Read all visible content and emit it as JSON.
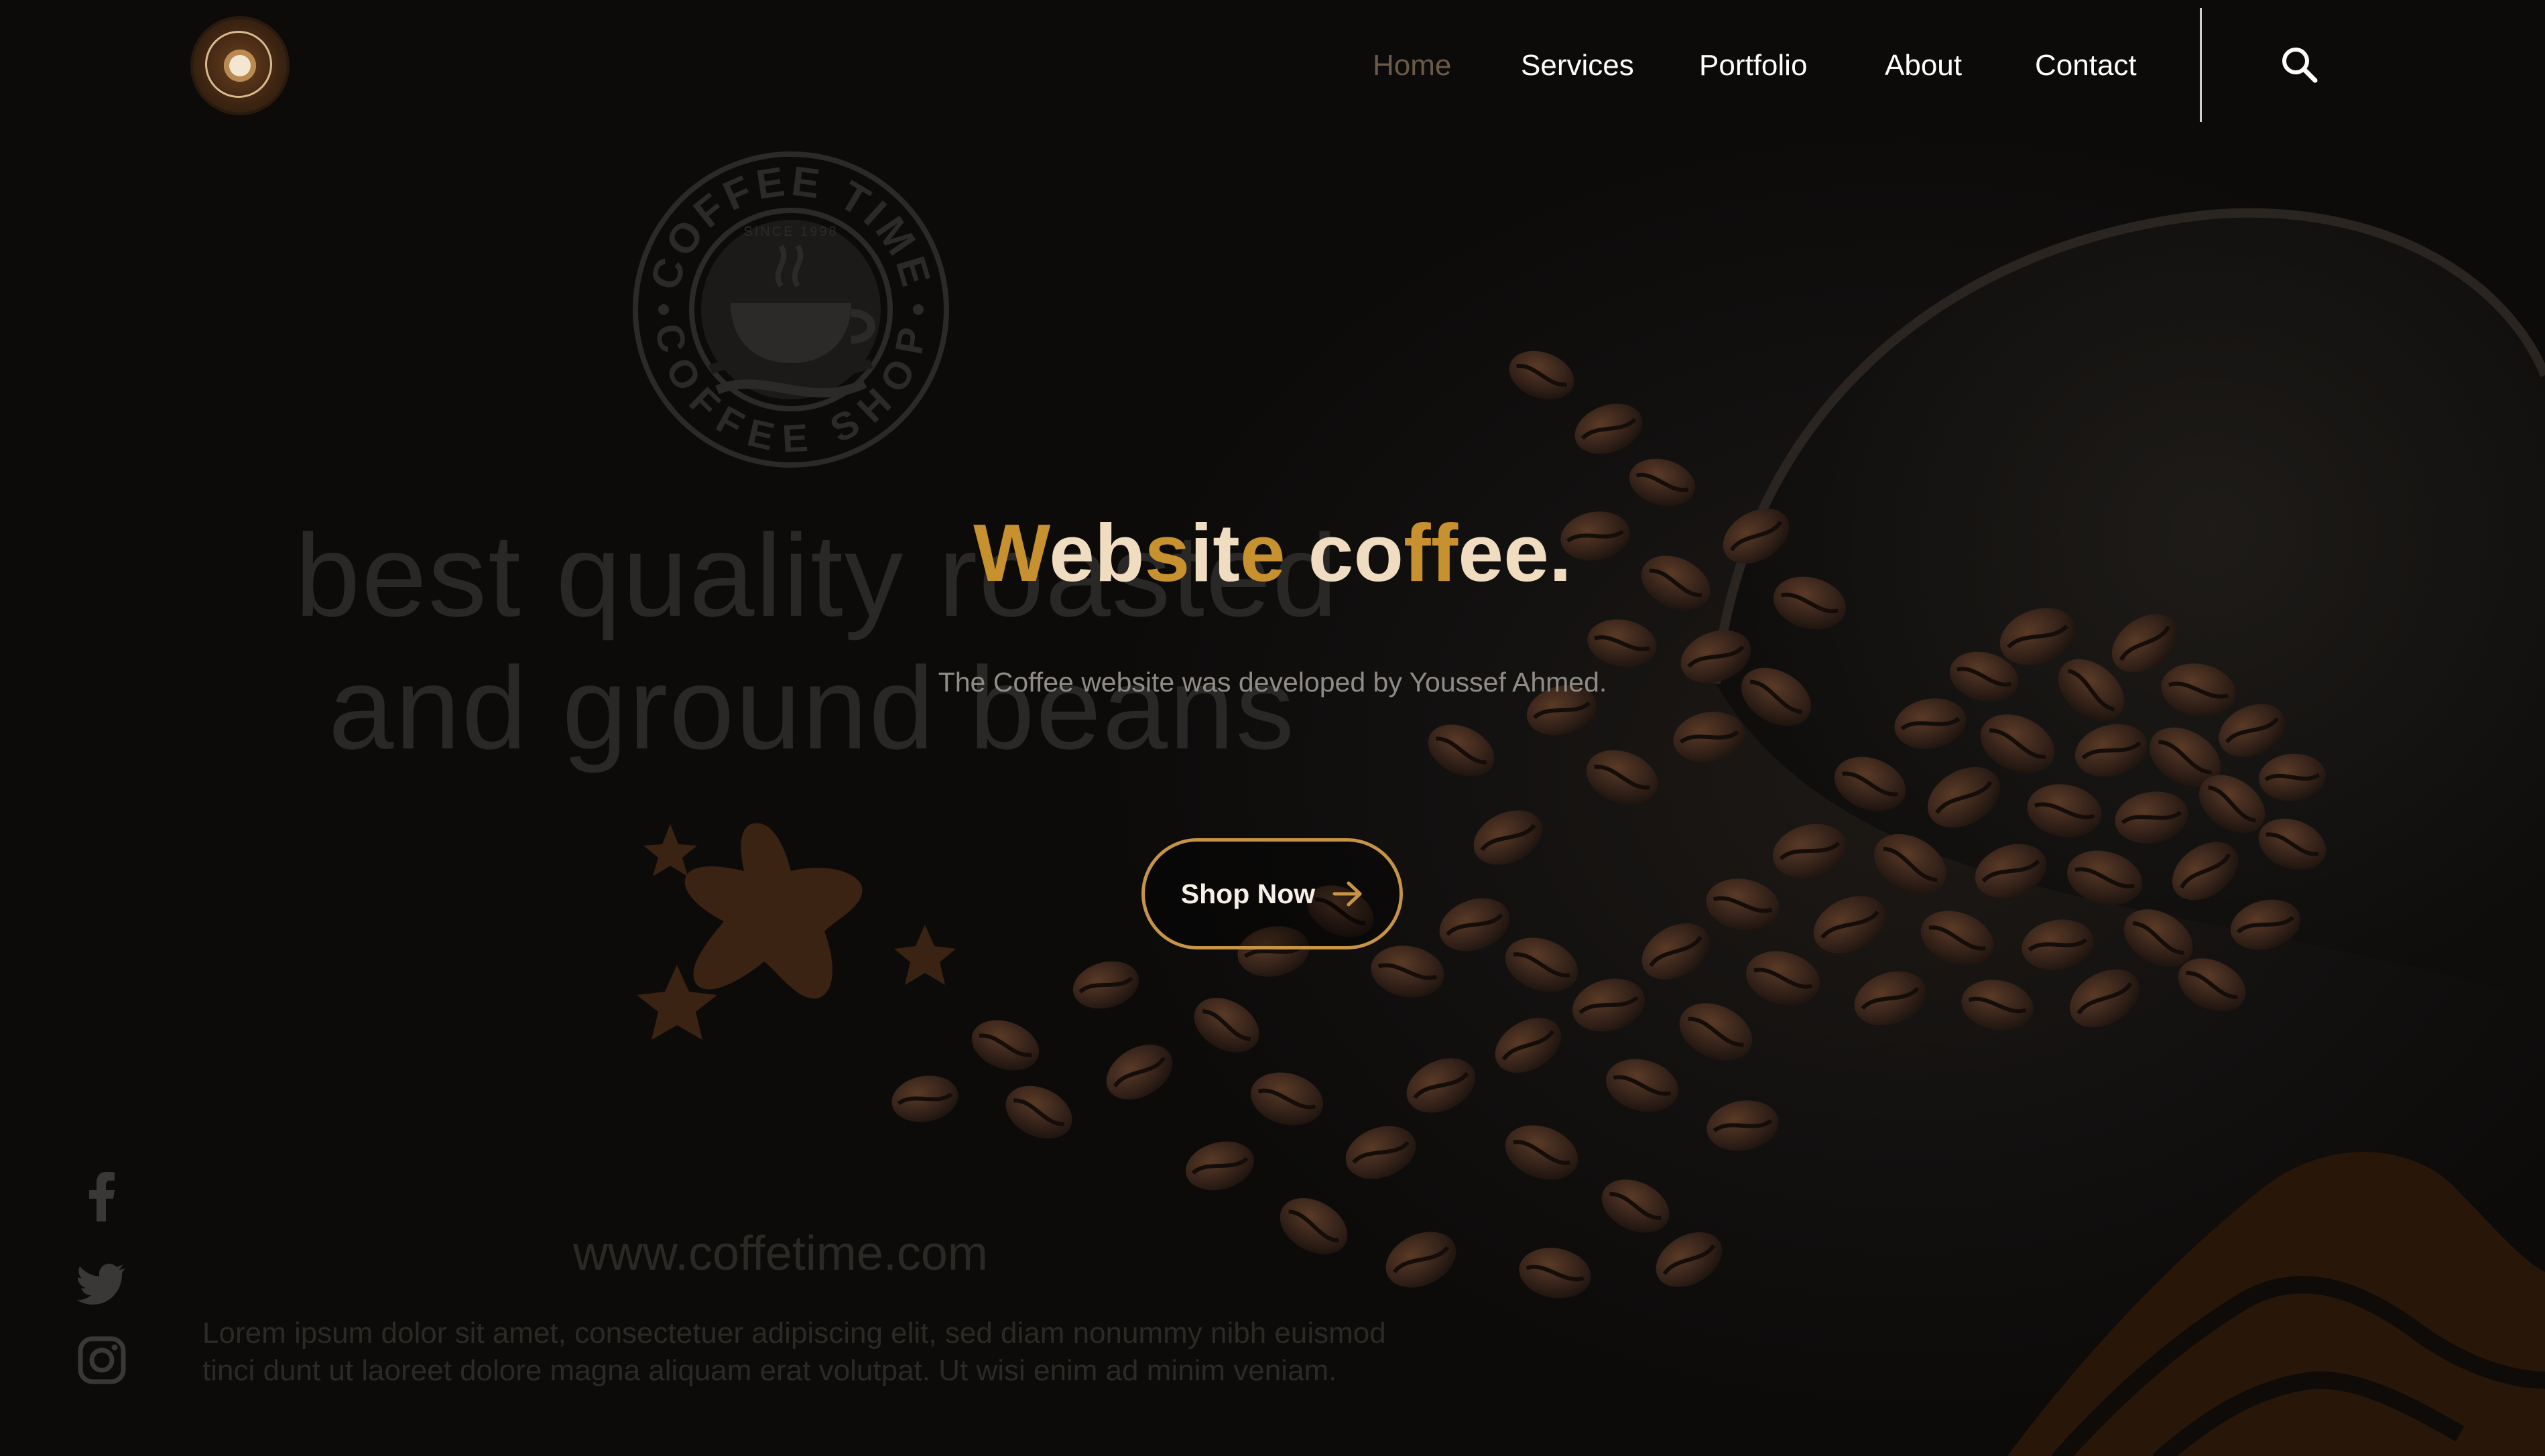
{
  "brand": {
    "logo_icon": "coffee-cup-logo-icon",
    "accent": "#c8912f",
    "cream": "#f0dcc0",
    "button_border": "#c79446",
    "active_nav": "#6b5a4a"
  },
  "nav": {
    "items": [
      {
        "label": "Home",
        "active": true
      },
      {
        "label": "Services",
        "active": false
      },
      {
        "label": "Portfolio",
        "active": false
      },
      {
        "label": "About",
        "active": false
      },
      {
        "label": "Contact",
        "active": false
      }
    ],
    "search_icon": "search-icon"
  },
  "background": {
    "stamp": {
      "top_text": "COFFEE TIME",
      "bottom_text": "COFFEE SHOP",
      "since": "SINCE 1998"
    },
    "tagline_line1": "best quality roasted",
    "tagline_line2": "and ground beans",
    "url": "www.coffetime.com",
    "lorem_line1": "Lorem ipsum dolor sit amet, consectetuer adipiscing elit, sed diam nonummy nibh euismod",
    "lorem_line2": "tinci dunt ut laoreet dolore magna aliquam erat volutpat. Ut wisi enim ad minim veniam."
  },
  "hero": {
    "title_parts": [
      {
        "text": "W",
        "tone": "gold"
      },
      {
        "text": "eb",
        "tone": "cream"
      },
      {
        "text": "s",
        "tone": "gold"
      },
      {
        "text": "it",
        "tone": "cream"
      },
      {
        "text": "e",
        "tone": "gold"
      },
      {
        "text": " co",
        "tone": "cream"
      },
      {
        "text": "ff",
        "tone": "gold"
      },
      {
        "text": "ee.",
        "tone": "cream"
      }
    ],
    "subtitle": "The Coffee website was developed by Youssef Ahmed.",
    "cta_label": "Shop Now",
    "cta_icon": "arrow-right-icon"
  },
  "social": [
    {
      "name": "facebook-icon"
    },
    {
      "name": "twitter-icon"
    },
    {
      "name": "instagram-icon"
    }
  ]
}
